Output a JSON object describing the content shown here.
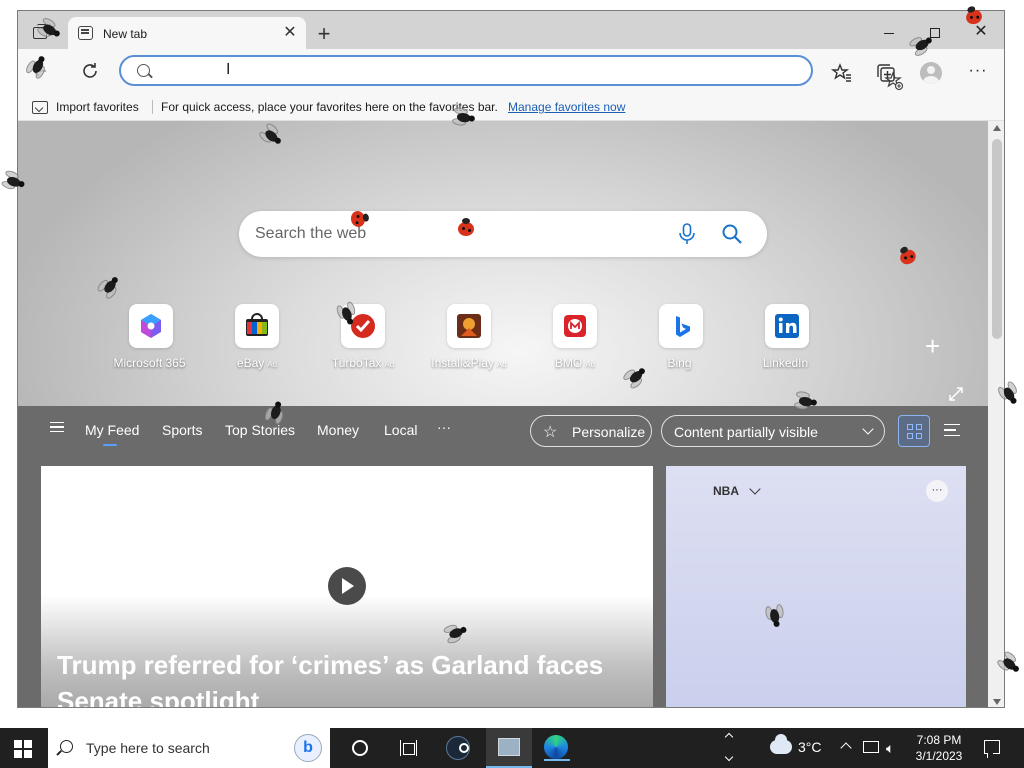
{
  "browser": {
    "tab_title": "New tab",
    "address_value": "",
    "address_placeholder": ""
  },
  "favorites_bar": {
    "import_label": "Import favorites",
    "message": "For quick access, place your favorites here on the favorites bar.",
    "manage_link": "Manage favorites now"
  },
  "page": {
    "search_placeholder": "Search the web",
    "quick_links": [
      {
        "label": "Microsoft 365",
        "ad": "",
        "icon": "microsoft-365-icon"
      },
      {
        "label": "eBay",
        "ad": "Ad",
        "icon": "ebay-icon"
      },
      {
        "label": "TurboTax",
        "ad": "Ad",
        "icon": "turbotax-icon"
      },
      {
        "label": "Install&Play",
        "ad": "Ad",
        "icon": "install-play-icon"
      },
      {
        "label": "BMO",
        "ad": "Ad",
        "icon": "bmo-icon"
      },
      {
        "label": "Bing",
        "ad": "",
        "icon": "bing-icon"
      },
      {
        "label": "LinkedIn",
        "ad": "",
        "icon": "linkedin-icon"
      }
    ],
    "feed_tabs": [
      "My Feed",
      "Sports",
      "Top Stories",
      "Money",
      "Local"
    ],
    "feed_more": "···",
    "personalize_label": "Personalize",
    "content_visibility": "Content partially visible",
    "hero_headline": "Trump referred for ‘crimes’ as Garland faces Senate spotlight",
    "side_card_title": "NBA",
    "card_more": "···"
  },
  "taskbar": {
    "search_placeholder": "Type here to search",
    "weather": "3°C",
    "time": "7:08 PM",
    "date": "3/1/2023"
  },
  "colors": {
    "accent": "#5a8fd6",
    "taskbar": "#202020",
    "feed_bar": "#6b6b6b",
    "link": "#1a5fb4"
  }
}
